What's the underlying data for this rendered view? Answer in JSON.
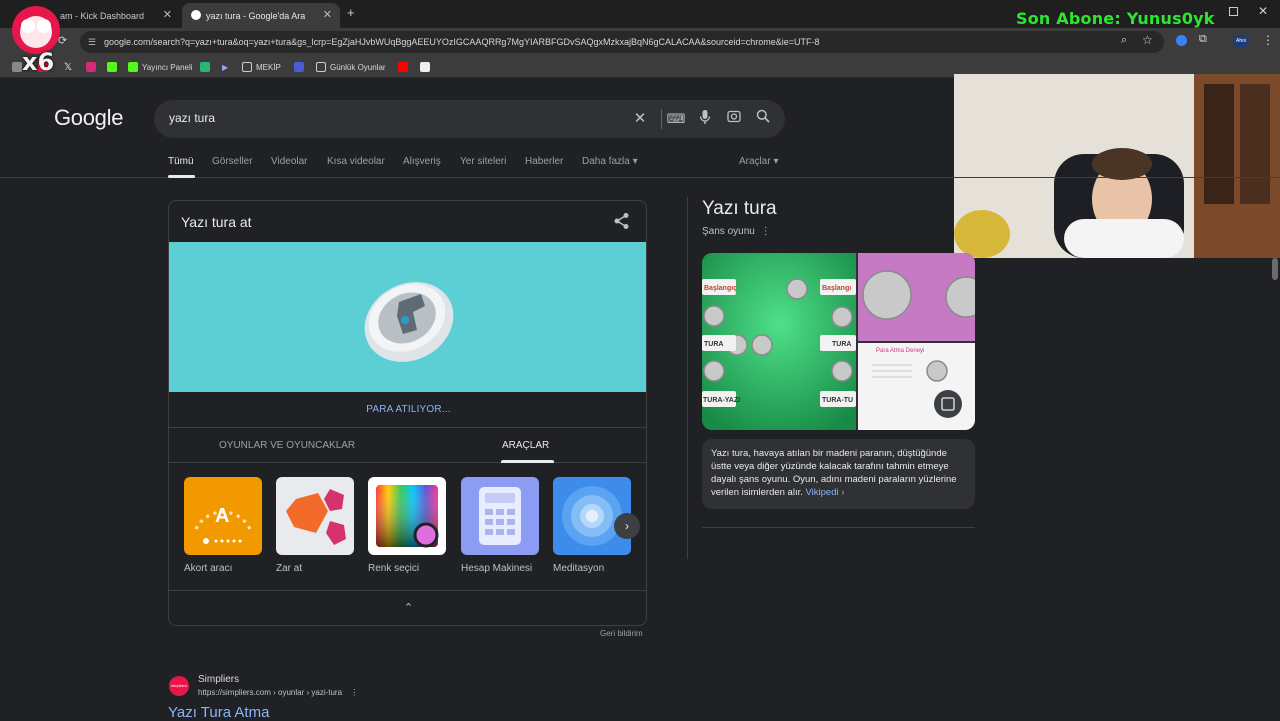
{
  "browser": {
    "tabs": [
      {
        "label": "am - Kick Dashboard",
        "active": false
      },
      {
        "label": "yazı tura - Google'da Ara",
        "active": true
      }
    ],
    "new_tab": "+",
    "url": "google.com/search?q=yazı+tura&oq=yazı+tura&gs_lcrp=EgZjaHJvbWUqBggAEEUYOzIGCAAQRRg7MgYIARBFGDvSAQgxMzkxajBqN6gCALACAA&sourceid=chrome&ie=UTF-8",
    "bookmarks": [
      {
        "label": "Yayıncı Paneli",
        "icon": "kick-icon"
      },
      {
        "label": "MEKİP",
        "icon": "folder-icon"
      },
      {
        "label": "Günlük Oyunlar",
        "icon": "folder-icon"
      }
    ],
    "profile_label": "Ahoi"
  },
  "overlay": {
    "subscriber_text": "Son Abone: Yunus0yk",
    "multiplier": "x6"
  },
  "google": {
    "logo": "Google",
    "query": "yazı tura",
    "nav_tabs": [
      "Tümü",
      "Görseller",
      "Videolar",
      "Kısa videolar",
      "Alışveriş",
      "Yer siteleri",
      "Haberler",
      "Daha fazla"
    ],
    "tools_label": "Araçlar"
  },
  "widget": {
    "title": "Yazı tura at",
    "status": "PARA ATILIYOR...",
    "subtabs": [
      "OYUNLAR VE OYUNCAKLAR",
      "ARAÇLAR"
    ],
    "tools": [
      {
        "label": "Akort aracı",
        "thumb_text": "A",
        "color": "#f29900"
      },
      {
        "label": "Zar at",
        "color": "#e8eaed"
      },
      {
        "label": "Renk seçici",
        "color": "#ffffff"
      },
      {
        "label": "Hesap Makinesi",
        "color": "#8c9cf2"
      },
      {
        "label": "Meditasyon",
        "color": "#3d8bea"
      }
    ],
    "feedback": "Geri bildirim"
  },
  "knowledge_panel": {
    "title": "Yazı tura",
    "subtitle": "Şans oyunu",
    "image_labels": [
      "Başlangıç",
      "Başlangı",
      "TURA",
      "TURA",
      "TURA-YAZI",
      "TURA-TU",
      "Para Atma Deneyi"
    ],
    "description": "Yazı tura, havaya atılan bir madeni paranın, düştüğünde üstte veya diğer yüzünde kalacak tarafını tahmin etmeye dayalı şans oyunu. Oyun, adını madeni paraların yüzlerine verilen isimlerden alır.",
    "source_link": "Vikipedi ›"
  },
  "result": {
    "favicon_text": "simpliers",
    "site": "Simpliers",
    "url": "https://simpliers.com › oyunlar › yazi-tura",
    "title": "Yazı Tura Atma"
  }
}
